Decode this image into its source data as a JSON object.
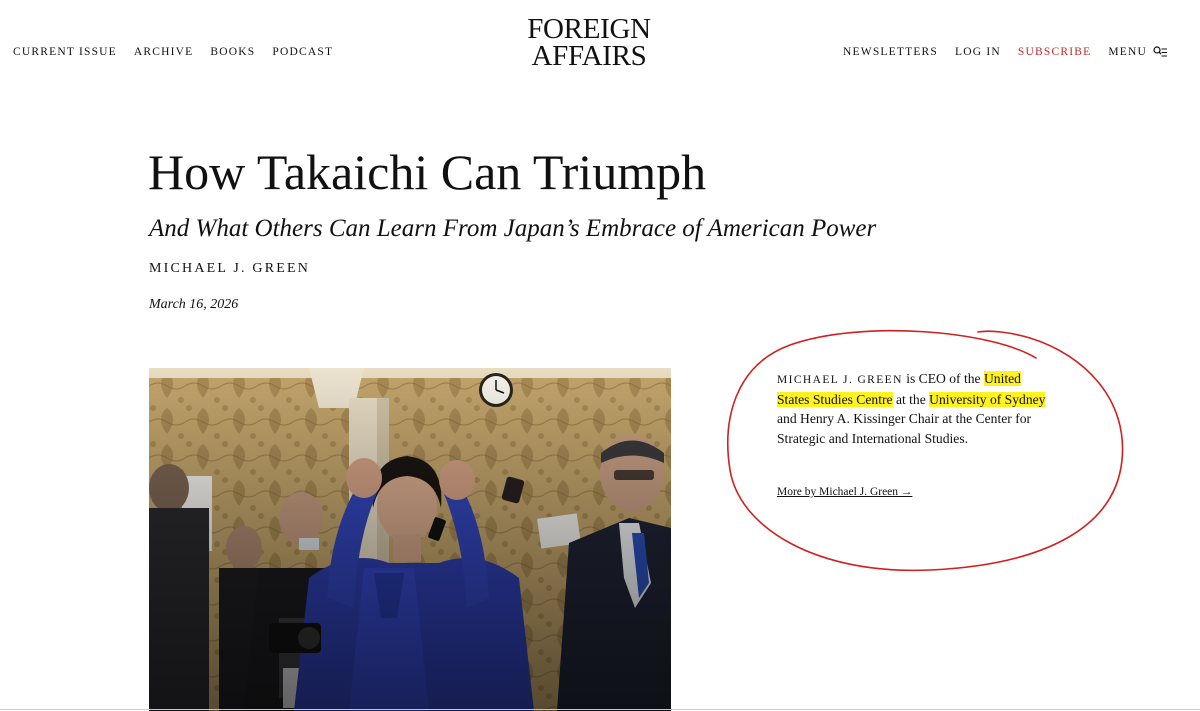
{
  "nav": {
    "left": [
      "CURRENT ISSUE",
      "ARCHIVE",
      "BOOKS",
      "PODCAST"
    ],
    "right": [
      "NEWSLETTERS",
      "LOG IN",
      "SUBSCRIBE"
    ],
    "menu_label": "MENU",
    "menu_icon": "search-menu-icon"
  },
  "logo": {
    "line1": "FOREIGN",
    "line2": "AFFAIRS"
  },
  "article": {
    "title": "How Takaichi Can Triumph",
    "subtitle": "And What Others Can Learn From Japan’s Embrace of American Power",
    "author": "MICHAEL J. GREEN",
    "date": "March 16, 2026"
  },
  "author_bio": {
    "name": "MICHAEL J. GREEN",
    "text_1": " is CEO of the ",
    "highlight_1": "United States Studies Centre",
    "text_2": " at the ",
    "highlight_2": "University of Sydney",
    "text_3": " and Henry A. Kissinger Chair at the Center for Strategic and International Studies.",
    "more_link": "More by Michael J. Green →"
  },
  "colors": {
    "subscribe": "#c0282a",
    "highlight": "#fff21f",
    "annotation": "#d0201f"
  }
}
